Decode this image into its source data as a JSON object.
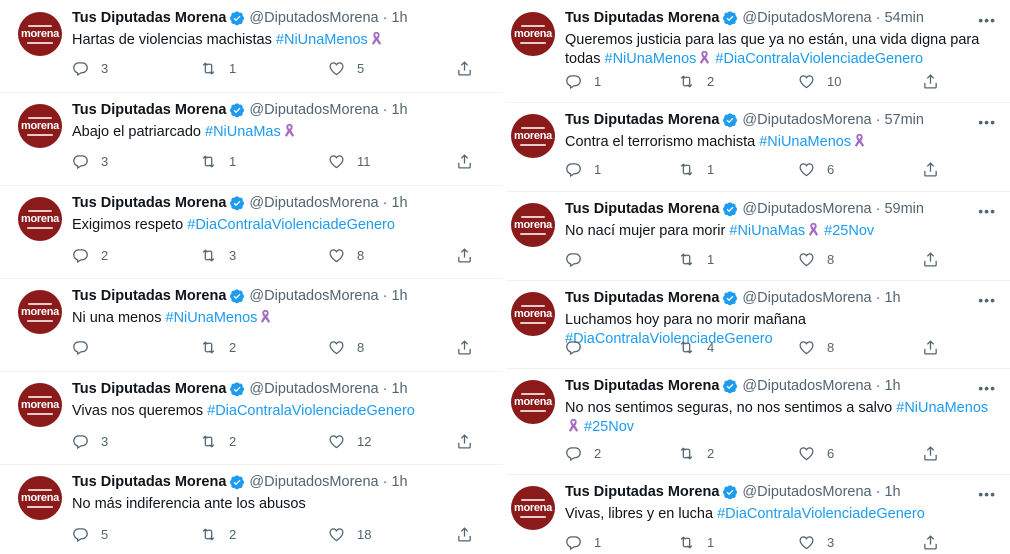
{
  "account": {
    "name": "Tus Diputadas Morena",
    "handle": "@DiputadosMorena",
    "separator": "·",
    "avatar_text": "morena"
  },
  "icons": {
    "reply": "reply-icon",
    "retweet": "retweet-icon",
    "like": "heart-icon",
    "share": "share-icon",
    "verified": "verified-badge-icon",
    "ribbon": "purple-ribbon-emoji"
  },
  "colors": {
    "accent": "#1d9bf0",
    "ribbon": "#a56cc1",
    "avatar": "#8b1a1a"
  },
  "left_tweets": [
    {
      "time": "1h",
      "segments": [
        {
          "t": "Hartas de violencias machistas "
        },
        {
          "t": "#NiUnaMenos",
          "tag": true
        },
        {
          "ribbon": true
        }
      ],
      "replies": "3",
      "retweets": "1",
      "likes": "5"
    },
    {
      "time": "1h",
      "segments": [
        {
          "t": "Abajo el patriarcado "
        },
        {
          "t": "#NiUnaMas",
          "tag": true
        },
        {
          "ribbon": true
        }
      ],
      "replies": "3",
      "retweets": "1",
      "likes": "11"
    },
    {
      "time": "1h",
      "segments": [
        {
          "t": "Exigimos respeto "
        },
        {
          "t": "#DiaContralaViolenciadeGenero",
          "tag": true
        }
      ],
      "replies": "2",
      "retweets": "3",
      "likes": "8"
    },
    {
      "time": "1h",
      "segments": [
        {
          "t": "Ni una menos "
        },
        {
          "t": "#NiUnaMenos",
          "tag": true
        },
        {
          "ribbon": true
        }
      ],
      "replies": "",
      "retweets": "2",
      "likes": "8"
    },
    {
      "time": "1h",
      "segments": [
        {
          "t": "Vivas nos queremos "
        },
        {
          "t": "#DiaContralaViolenciadeGenero",
          "tag": true
        }
      ],
      "replies": "3",
      "retweets": "2",
      "likes": "12"
    },
    {
      "time": "1h",
      "segments": [
        {
          "t": "No más indiferencia ante los abusos"
        }
      ],
      "replies": "5",
      "retweets": "2",
      "likes": "18"
    }
  ],
  "right_tweets": [
    {
      "time": "54min",
      "segments": [
        {
          "t": "Queremos justicia para las que ya no están, una vida digna para todas "
        },
        {
          "t": "#NiUnaMenos",
          "tag": true
        },
        {
          "ribbon": true
        },
        {
          "t": " "
        },
        {
          "t": "#DiaContralaViolenciadeGenero",
          "tag": true
        }
      ],
      "replies": "1",
      "retweets": "2",
      "likes": "10"
    },
    {
      "time": "57min",
      "segments": [
        {
          "t": "Contra el terrorismo machista "
        },
        {
          "t": "#NiUnaMenos",
          "tag": true
        },
        {
          "ribbon": true
        }
      ],
      "replies": "1",
      "retweets": "1",
      "likes": "6"
    },
    {
      "time": "59min",
      "segments": [
        {
          "t": "No nací mujer para morir  "
        },
        {
          "t": "#NiUnaMas",
          "tag": true
        },
        {
          "ribbon": true
        },
        {
          "t": " "
        },
        {
          "t": "#25Nov",
          "tag": true
        }
      ],
      "replies": "",
      "retweets": "1",
      "likes": "8"
    },
    {
      "time": "1h",
      "segments": [
        {
          "t": "Luchamos hoy para no morir mañana "
        },
        {
          "t": "#DiaContralaViolenciadeGenero",
          "tag": true
        }
      ],
      "replies": "",
      "retweets": "4",
      "likes": "8"
    },
    {
      "time": "1h",
      "segments": [
        {
          "t": "No nos sentimos seguras, no nos sentimos a salvo "
        },
        {
          "t": "#NiUnaMenos",
          "tag": true
        },
        {
          "ribbon": true
        },
        {
          "t": " "
        },
        {
          "t": "#25Nov",
          "tag": true
        }
      ],
      "replies": "2",
      "retweets": "2",
      "likes": "6"
    },
    {
      "time": "1h",
      "segments": [
        {
          "t": "Vivas, libres y en lucha "
        },
        {
          "t": "#DiaContralaViolenciadeGenero",
          "tag": true
        }
      ],
      "replies": "1",
      "retweets": "1",
      "likes": "3"
    }
  ]
}
